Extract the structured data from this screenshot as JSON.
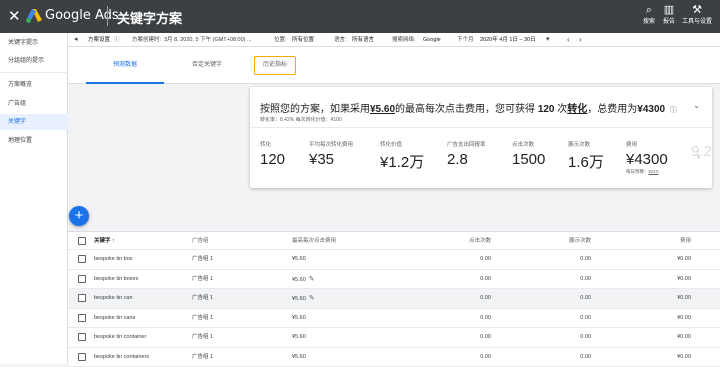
{
  "topbar": {
    "close_glyph": "✕",
    "brand": "Google Ads",
    "title": "关键字方案",
    "tools": [
      {
        "icon": "search-icon",
        "glyph": "⌕",
        "label": "搜索"
      },
      {
        "icon": "report-icon",
        "glyph": "▥",
        "label": "报告"
      },
      {
        "icon": "wrench-icon",
        "glyph": "⚒",
        "label": "工具与设置"
      }
    ]
  },
  "sidebar": {
    "items": [
      {
        "label": "关键字提示"
      },
      {
        "label": "分组组的提示"
      },
      {
        "label": "方案概览"
      },
      {
        "label": "广告组"
      },
      {
        "label": "关键字"
      },
      {
        "label": "地理位置"
      }
    ],
    "active_index": 4
  },
  "filterbar": {
    "collapse_glyph": "◂",
    "settings_label": "方案设置",
    "info_glyph": "ⓘ",
    "created_label": "方案创建时:",
    "created_value": "3月 8, 2020, 5 下午 (GMT+08:00) ...",
    "location_label": "位置:",
    "location_value": "所有位置",
    "language_label": "语言:",
    "language_value": "所有语言",
    "network_label": "搜索网络:",
    "network_value": "Google",
    "period_label": "下个月",
    "period_value": "2020年 4月 1日 – 30日",
    "dropdown_glyph": "▾",
    "prev_glyph": "‹",
    "next_glyph": "›"
  },
  "tabs": [
    {
      "label": "预测数据"
    },
    {
      "label": "否定关键字"
    },
    {
      "label": "历史指标"
    }
  ],
  "summary": {
    "headline_prefix": "按照您的方案，如果采用",
    "bid": "¥5.60",
    "headline_mid": "的最高每次点击费用，您可获得",
    "conversions": "120",
    "headline_unit": "次",
    "conversions_word": "转化",
    "headline_cost_label": "，总费用为",
    "total_cost": "¥4300",
    "help_glyph": "ⓘ",
    "expand_glyph": "⌄",
    "subline": "转化率：8.42%   每次转化价值：¥100",
    "next_glyph": "›",
    "metrics": [
      {
        "label": "转化",
        "value": "120"
      },
      {
        "label": "平均每次转化费用",
        "value": "¥35"
      },
      {
        "label": "转化价值",
        "value": "¥1.2万"
      },
      {
        "label": "广告支出回报率",
        "value": "2.8"
      },
      {
        "label": "点击次数",
        "value": "1500"
      },
      {
        "label": "展示次数",
        "value": "1.6万"
      },
      {
        "label": "费用",
        "value": "¥4300",
        "foot_label": "每日预算：",
        "foot_value": "¥210"
      },
      {
        "label": "",
        "value": "9.2"
      }
    ]
  },
  "fab": {
    "glyph": "+"
  },
  "table": {
    "columns": [
      "关键字",
      "广告组",
      "最高每次点击费用",
      "点击次数",
      "展示次数",
      "费用"
    ],
    "sort_glyph": "↑",
    "edit_glyph": "✎",
    "rows": [
      {
        "keyword": "bespoke tin box",
        "ad_group": "广告组 1",
        "max_cpc": "¥5.60",
        "clicks": "0.00",
        "impressions": "0.00",
        "cost": "¥0.00",
        "edit": false
      },
      {
        "keyword": "bespoke tin boxes",
        "ad_group": "广告组 1",
        "max_cpc": "¥5.60",
        "clicks": "0.00",
        "impressions": "0.00",
        "cost": "¥0.00",
        "edit": true
      },
      {
        "keyword": "bespoke tin can",
        "ad_group": "广告组 1",
        "max_cpc": "¥5.60",
        "clicks": "0.00",
        "impressions": "0.00",
        "cost": "¥0.00",
        "edit": true
      },
      {
        "keyword": "bespoke tin cans",
        "ad_group": "广告组 1",
        "max_cpc": "¥5.60",
        "clicks": "0.00",
        "impressions": "0.00",
        "cost": "¥0.00",
        "edit": false
      },
      {
        "keyword": "bespoke tin container",
        "ad_group": "广告组 1",
        "max_cpc": "¥5.60",
        "clicks": "0.00",
        "impressions": "0.00",
        "cost": "¥0.00",
        "edit": false
      },
      {
        "keyword": "bespoke tin containers",
        "ad_group": "广告组 1",
        "max_cpc": "¥5.60",
        "clicks": "0.00",
        "impressions": "0.00",
        "cost": "¥0.00",
        "edit": false
      }
    ]
  },
  "colors": {
    "topbar": "#3c4043",
    "accent": "#1a73e8",
    "highlight": "#f9ab00"
  }
}
